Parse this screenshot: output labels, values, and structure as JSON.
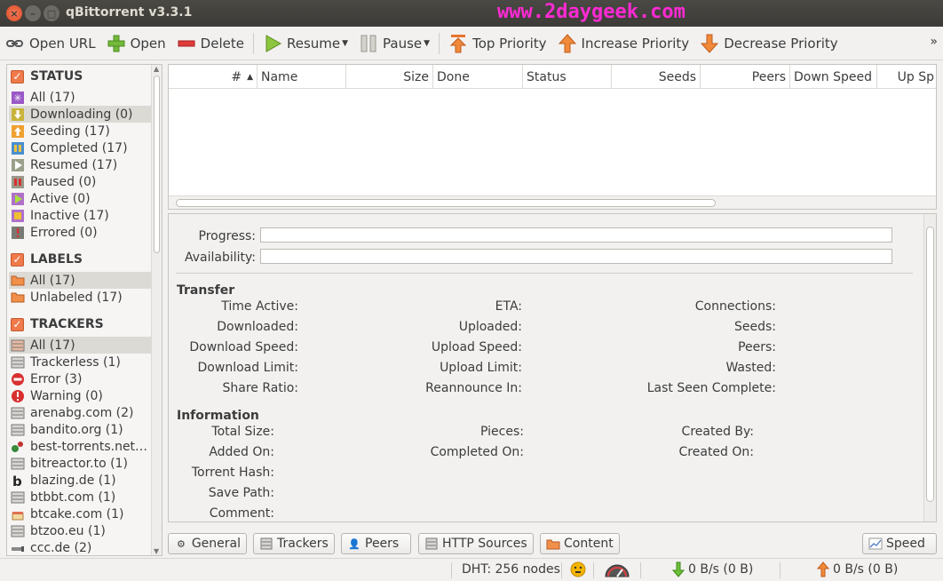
{
  "window": {
    "title": "qBittorrent v3.3.1",
    "watermark": "www.2daygeek.com"
  },
  "toolbar": {
    "open_url": "Open URL",
    "open": "Open",
    "delete": "Delete",
    "resume": "Resume",
    "pause": "Pause",
    "top_priority": "Top Priority",
    "increase_priority": "Increase Priority",
    "decrease_priority": "Decrease Priority",
    "more": "»"
  },
  "sidebar": {
    "status_title": "STATUS",
    "status_items": [
      {
        "label": "All (17)",
        "icon": "all-icon",
        "color": "#9b59c7"
      },
      {
        "label": "Downloading (0)",
        "icon": "downloading-icon",
        "color": "#c9b43b"
      },
      {
        "label": "Seeding (17)",
        "icon": "seeding-icon",
        "color": "#f0a030"
      },
      {
        "label": "Completed (17)",
        "icon": "completed-icon",
        "color": "#4a8fd0"
      },
      {
        "label": "Resumed (17)",
        "icon": "resumed-icon",
        "color": "#7a8a6a"
      },
      {
        "label": "Paused (0)",
        "icon": "paused-icon",
        "color": "#8a8a7a"
      },
      {
        "label": "Active (0)",
        "icon": "active-icon",
        "color": "#8fbf2a"
      },
      {
        "label": "Inactive (17)",
        "icon": "inactive-icon",
        "color": "#d9a020"
      },
      {
        "label": "Errored (0)",
        "icon": "errored-icon",
        "color": "#6a6a64"
      }
    ],
    "labels_title": "LABELS",
    "label_items": [
      {
        "label": "All (17)",
        "icon": "folder-icon"
      },
      {
        "label": "Unlabeled (17)",
        "icon": "folder-icon"
      }
    ],
    "trackers_title": "TRACKERS",
    "tracker_items": [
      {
        "label": "All (17)",
        "icon": "trackers-all-icon"
      },
      {
        "label": "Trackerless (1)",
        "icon": "server-icon"
      },
      {
        "label": "Error (3)",
        "icon": "error-icon"
      },
      {
        "label": "Warning (0)",
        "icon": "warning-icon"
      },
      {
        "label": "arenabg.com (2)",
        "icon": "server-icon"
      },
      {
        "label": "bandito.org (1)",
        "icon": "server-icon"
      },
      {
        "label": "best-torrents.net…",
        "icon": "favicon-icon"
      },
      {
        "label": "bitreactor.to (1)",
        "icon": "server-icon"
      },
      {
        "label": "blazing.de (1)",
        "icon": "favicon-b-icon"
      },
      {
        "label": "btbbt.com (1)",
        "icon": "server-icon"
      },
      {
        "label": "btcake.com (1)",
        "icon": "favicon-cake-icon"
      },
      {
        "label": "btzoo.eu (1)",
        "icon": "server-icon"
      },
      {
        "label": "ccc.de (2)",
        "icon": "favicon-ccc-icon"
      }
    ]
  },
  "list": {
    "columns": [
      "#",
      "Name",
      "Size",
      "Done",
      "Status",
      "Seeds",
      "Peers",
      "Down Speed",
      "Up Sp"
    ]
  },
  "props": {
    "progress": "Progress:",
    "availability": "Availability:",
    "transfer_title": "Transfer",
    "transfer": {
      "col1": [
        "Time Active:",
        "Downloaded:",
        "Download Speed:",
        "Download Limit:",
        "Share Ratio:"
      ],
      "col2": [
        "ETA:",
        "Uploaded:",
        "Upload Speed:",
        "Upload Limit:",
        "Reannounce In:"
      ],
      "col3": [
        "Connections:",
        "Seeds:",
        "Peers:",
        "Wasted:",
        "Last Seen Complete:"
      ]
    },
    "info_title": "Information",
    "info": {
      "col1": [
        "Total Size:",
        "Added On:",
        "Torrent Hash:",
        "Save Path:",
        "Comment:"
      ],
      "col2": [
        "Pieces:",
        "Completed On:"
      ],
      "col3": [
        "Created By:",
        "Created On:"
      ]
    }
  },
  "tabs": {
    "general": "General",
    "trackers": "Trackers",
    "peers": "Peers",
    "http_sources": "HTTP Sources",
    "content": "Content",
    "speed": "Speed"
  },
  "status": {
    "dht": "DHT: 256 nodes",
    "down": "0 B/s (0 B)",
    "up": "0 B/s (0 B)"
  }
}
